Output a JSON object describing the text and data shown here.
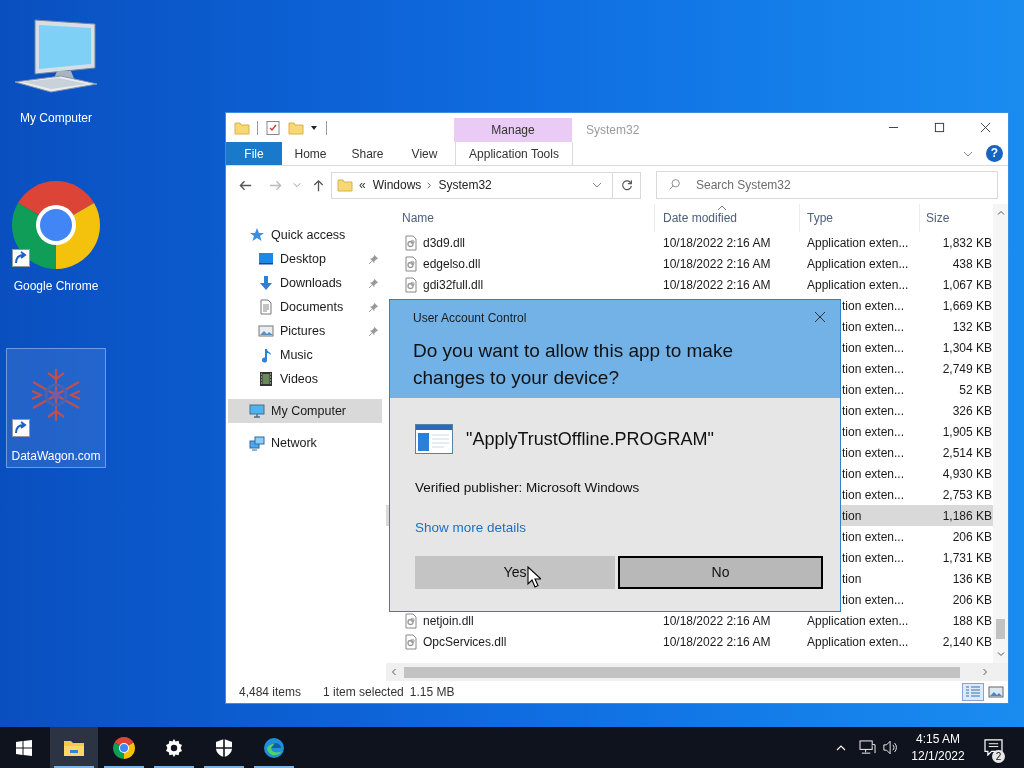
{
  "desktop_icons": [
    {
      "label": "My Computer",
      "kind": "computer",
      "shortcut": false,
      "selected": false
    },
    {
      "label": "Google Chrome",
      "kind": "chrome",
      "shortcut": true,
      "selected": false
    },
    {
      "label": "DataWagon.com",
      "kind": "datawagon",
      "shortcut": true,
      "selected": true
    }
  ],
  "explorer": {
    "title": "System32",
    "contextual_tab": "Manage",
    "help_label": "?",
    "ribbon_tabs": [
      {
        "label": "File",
        "kind": "file"
      },
      {
        "label": "Home",
        "kind": "tab"
      },
      {
        "label": "Share",
        "kind": "tab"
      },
      {
        "label": "View",
        "kind": "tab"
      },
      {
        "label": "Application Tools",
        "kind": "contextual"
      }
    ],
    "address": {
      "overflow": "«",
      "crumbs": [
        "Windows",
        "System32"
      ]
    },
    "search": {
      "placeholder": "Search System32"
    },
    "sidebar": [
      {
        "label": "Quick access",
        "kind": "star",
        "selected": false,
        "children": [
          {
            "label": "Desktop",
            "kind": "desktop",
            "pinned": true,
            "selected": false
          },
          {
            "label": "Downloads",
            "kind": "download",
            "pinned": true,
            "selected": false
          },
          {
            "label": "Documents",
            "kind": "document",
            "pinned": true,
            "selected": false
          },
          {
            "label": "Pictures",
            "kind": "picture",
            "pinned": true,
            "selected": false
          },
          {
            "label": "Music",
            "kind": "music",
            "pinned": false,
            "selected": false
          },
          {
            "label": "Videos",
            "kind": "video",
            "pinned": false,
            "selected": false
          }
        ]
      },
      {
        "label": "My Computer",
        "kind": "computer",
        "selected": true
      },
      {
        "label": "Network",
        "kind": "network",
        "selected": false
      }
    ],
    "columns": [
      {
        "label": "Name",
        "sorted": false
      },
      {
        "label": "Date modified",
        "sorted": true
      },
      {
        "label": "Type",
        "sorted": false
      },
      {
        "label": "Size",
        "sorted": false
      }
    ],
    "rows": [
      {
        "kind": "full",
        "name": "d3d9.dll",
        "date": "10/18/2022 2:16 AM",
        "type": "Application exten...",
        "size": "1,832 KB",
        "selected": false
      },
      {
        "kind": "full",
        "name": "edgelso.dll",
        "date": "10/18/2022 2:16 AM",
        "type": "Application exten...",
        "size": "438 KB",
        "selected": false
      },
      {
        "kind": "full",
        "name": "gdi32full.dll",
        "date": "10/18/2022 2:16 AM",
        "type": "Application exten...",
        "size": "1,067 KB",
        "selected": false
      },
      {
        "kind": "covered",
        "type": "tion exten...",
        "size": "1,669 KB",
        "selected": false
      },
      {
        "kind": "covered",
        "type": "tion exten...",
        "size": "132 KB",
        "selected": false
      },
      {
        "kind": "covered",
        "type": "tion exten...",
        "size": "1,304 KB",
        "selected": false
      },
      {
        "kind": "covered",
        "type": "tion exten...",
        "size": "2,749 KB",
        "selected": false
      },
      {
        "kind": "covered",
        "type": "tion exten...",
        "size": "52 KB",
        "selected": false
      },
      {
        "kind": "covered",
        "type": "tion exten...",
        "size": "326 KB",
        "selected": false
      },
      {
        "kind": "covered",
        "type": "tion exten...",
        "size": "1,905 KB",
        "selected": false
      },
      {
        "kind": "covered",
        "type": "tion exten...",
        "size": "2,514 KB",
        "selected": false
      },
      {
        "kind": "covered",
        "type": "tion exten...",
        "size": "4,930 KB",
        "selected": false
      },
      {
        "kind": "covered",
        "type": "tion exten...",
        "size": "2,753 KB",
        "selected": false
      },
      {
        "kind": "covered",
        "type": "tion",
        "size": "1,186 KB",
        "selected": true
      },
      {
        "kind": "covered",
        "type": "tion exten...",
        "size": "206 KB",
        "selected": false
      },
      {
        "kind": "covered",
        "type": "tion exten...",
        "size": "1,731 KB",
        "selected": false
      },
      {
        "kind": "covered",
        "type": "tion",
        "size": "136 KB",
        "selected": false
      },
      {
        "kind": "covered",
        "type": "tion exten...",
        "size": "206 KB",
        "selected": false
      },
      {
        "kind": "full",
        "name": "netjoin.dll",
        "date": "10/18/2022 2:16 AM",
        "type": "Application exten...",
        "size": "188 KB",
        "selected": false
      },
      {
        "kind": "full",
        "name": "OpcServices.dll",
        "date": "10/18/2022 2:16 AM",
        "type": "Application exten...",
        "size": "2,140 KB",
        "selected": false
      }
    ],
    "status": {
      "items": "4,484 items",
      "selection": "1 item selected",
      "selection_size": "1.15 MB"
    },
    "views": [
      {
        "kind": "details",
        "selected": true
      },
      {
        "kind": "tiles",
        "selected": false
      }
    ]
  },
  "uac": {
    "title": "User Account Control",
    "question": "Do you want to allow this app to make changes to your device?",
    "program": "\"ApplyTrustOffline.PROGRAM\"",
    "publisher": "Verified publisher: Microsoft Windows",
    "details_link": "Show more details",
    "buttons": [
      {
        "label": "Yes",
        "focused": false
      },
      {
        "label": "No",
        "focused": true
      }
    ]
  },
  "taskbar": {
    "apps": [
      {
        "kind": "explorer",
        "active": true,
        "running": true
      },
      {
        "kind": "chrome",
        "active": false,
        "running": true
      },
      {
        "kind": "settings",
        "active": false,
        "running": true
      },
      {
        "kind": "security",
        "active": false,
        "running": true
      },
      {
        "kind": "edge",
        "active": false,
        "running": true
      }
    ],
    "time": "4:15 AM",
    "date": "12/1/2022",
    "notifications": "2"
  }
}
